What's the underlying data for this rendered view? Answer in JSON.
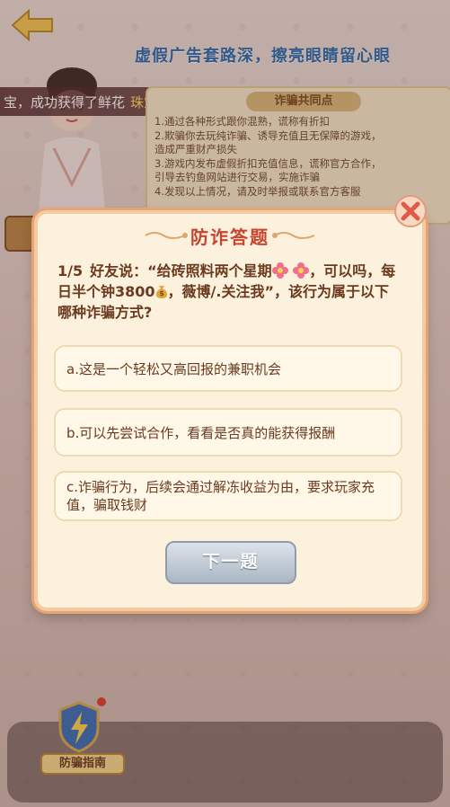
{
  "header": {
    "banner_title": "虚假广告套路深，擦亮眼睛留心眼"
  },
  "ticker": {
    "prefix": "宝，成功获得了鲜花",
    "highlight": "珠宝之心。"
  },
  "fraud_card": {
    "title": "诈骗共同点",
    "lines": [
      "1.通过各种形式跟你混熟，谎称有折扣",
      "2.欺骗你去玩纯诈骗、诱导充值且无保障的游戏，",
      "  造成严重财产损失",
      "3.游戏内发布虚假折扣充值信息，谎称官方合作，",
      "  引导去钓鱼网站进行交易，实施诈骗",
      "4.发现以上情况，请及时举报或联系官方客服"
    ]
  },
  "modal": {
    "title": "防诈答题",
    "progress": "1/5",
    "question_part1": "好友说：“给砖照料两个星期",
    "question_part2": "，可以吗，每日半个钟3800",
    "question_part3": "，薇博/.关注我”，该行为属于以下哪种诈骗方式?",
    "options": [
      {
        "label": "a.这是一个轻松又高回报的兼职机会"
      },
      {
        "label": "b.可以先尝试合作，看看是否真的能获得报酬"
      },
      {
        "label": "c.诈骗行为，后续会通过解冻收益为由，要求玩家充值，骗取钱财"
      }
    ],
    "next_label": "下一题"
  },
  "guide": {
    "label": "防骗指南"
  },
  "colors": {
    "title_red": "#c8442f",
    "banner_blue": "#2d6aa8",
    "highlight_gold": "#ffd75a"
  }
}
